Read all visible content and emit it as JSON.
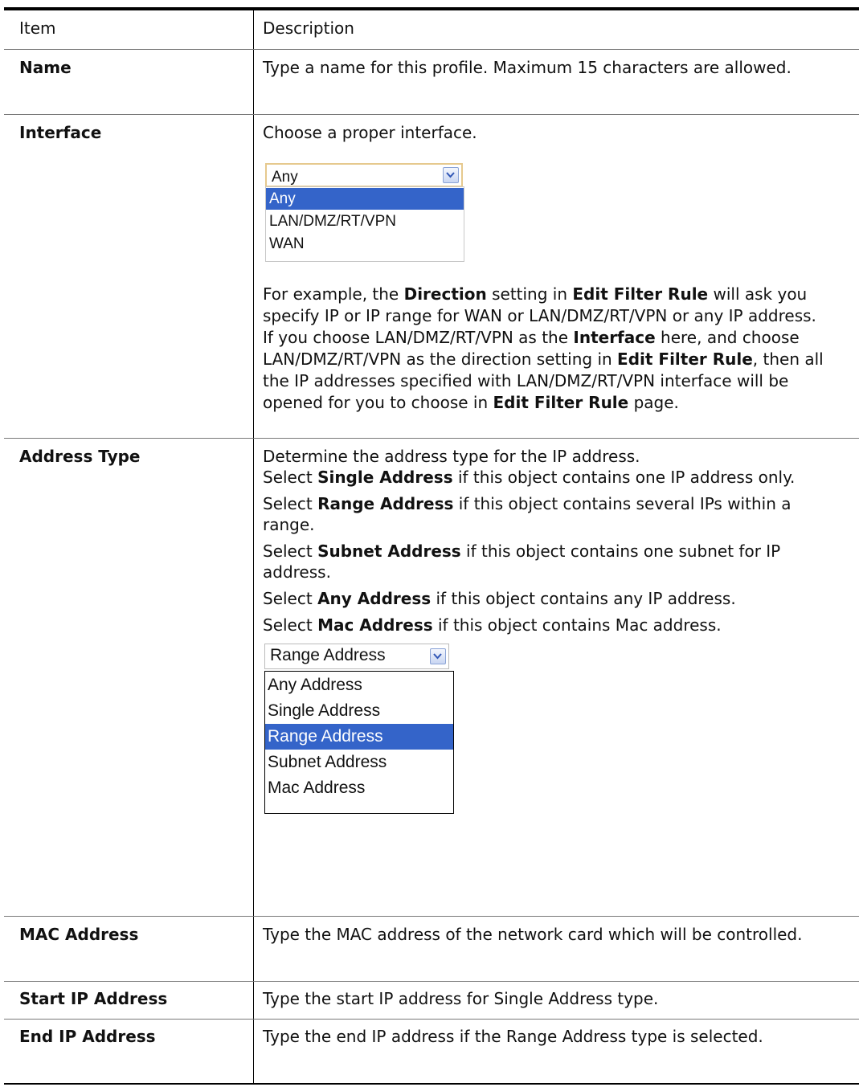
{
  "header": {
    "item": "Item",
    "description": "Description"
  },
  "rows": {
    "name": {
      "item": "Name",
      "text": "Type a name for this profile. Maximum 15 characters are allowed."
    },
    "interface": {
      "item": "Interface",
      "intro": "Choose a proper interface.",
      "widget": {
        "selected": "Any",
        "options": [
          "Any",
          "LAN/DMZ/RT/VPN",
          "WAN"
        ],
        "highlighted": "Any"
      },
      "p_a": "For example, the ",
      "p_b": "Direction",
      "p_c": " setting in ",
      "p_d": "Edit Filter Rule",
      "p_e": " will ask you specify IP or IP range for WAN or LAN/DMZ/RT/VPN or any IP address. If you choose LAN/DMZ/RT/VPN as the ",
      "p_f": "Interface",
      "p_g": " here, and choose LAN/DMZ/RT/VPN as the direction setting in ",
      "p_h": "Edit Filter Rule",
      "p_i": ", then all the IP addresses specified with LAN/DMZ/RT/VPN interface will be opened for you to choose in ",
      "p_j": "Edit Filter Rule",
      "p_k": " page."
    },
    "address_type": {
      "item": "Address Type",
      "l1": "Determine the address type for the IP address.",
      "l2a": "Select ",
      "l2b": "Single Address",
      "l2c": " if this object contains one IP address only.",
      "l3a": "Select ",
      "l3b": "Range Address",
      "l3c": " if this object contains several IPs within a range.",
      "l4a": "Select ",
      "l4b": "Subnet Address",
      "l4c": " if this object contains one subnet for IP address.",
      "l5a": "Select ",
      "l5b": "Any Address",
      "l5c": " if this object contains any IP address.",
      "l6a": "Select ",
      "l6b": "Mac Address",
      "l6c": " if this object contains Mac address.",
      "widget": {
        "selected": "Range Address",
        "options": [
          "Any Address",
          "Single Address",
          "Range Address",
          "Subnet Address",
          "Mac Address"
        ],
        "highlighted": "Range Address"
      }
    },
    "mac": {
      "item": "MAC Address",
      "text": "Type the MAC address of the network card which will be controlled."
    },
    "start_ip": {
      "item": "Start IP Address",
      "text": "Type the start IP address for Single Address type."
    },
    "end_ip": {
      "item": "End IP Address",
      "text": "Type the end IP address if the Range Address type is selected."
    }
  }
}
